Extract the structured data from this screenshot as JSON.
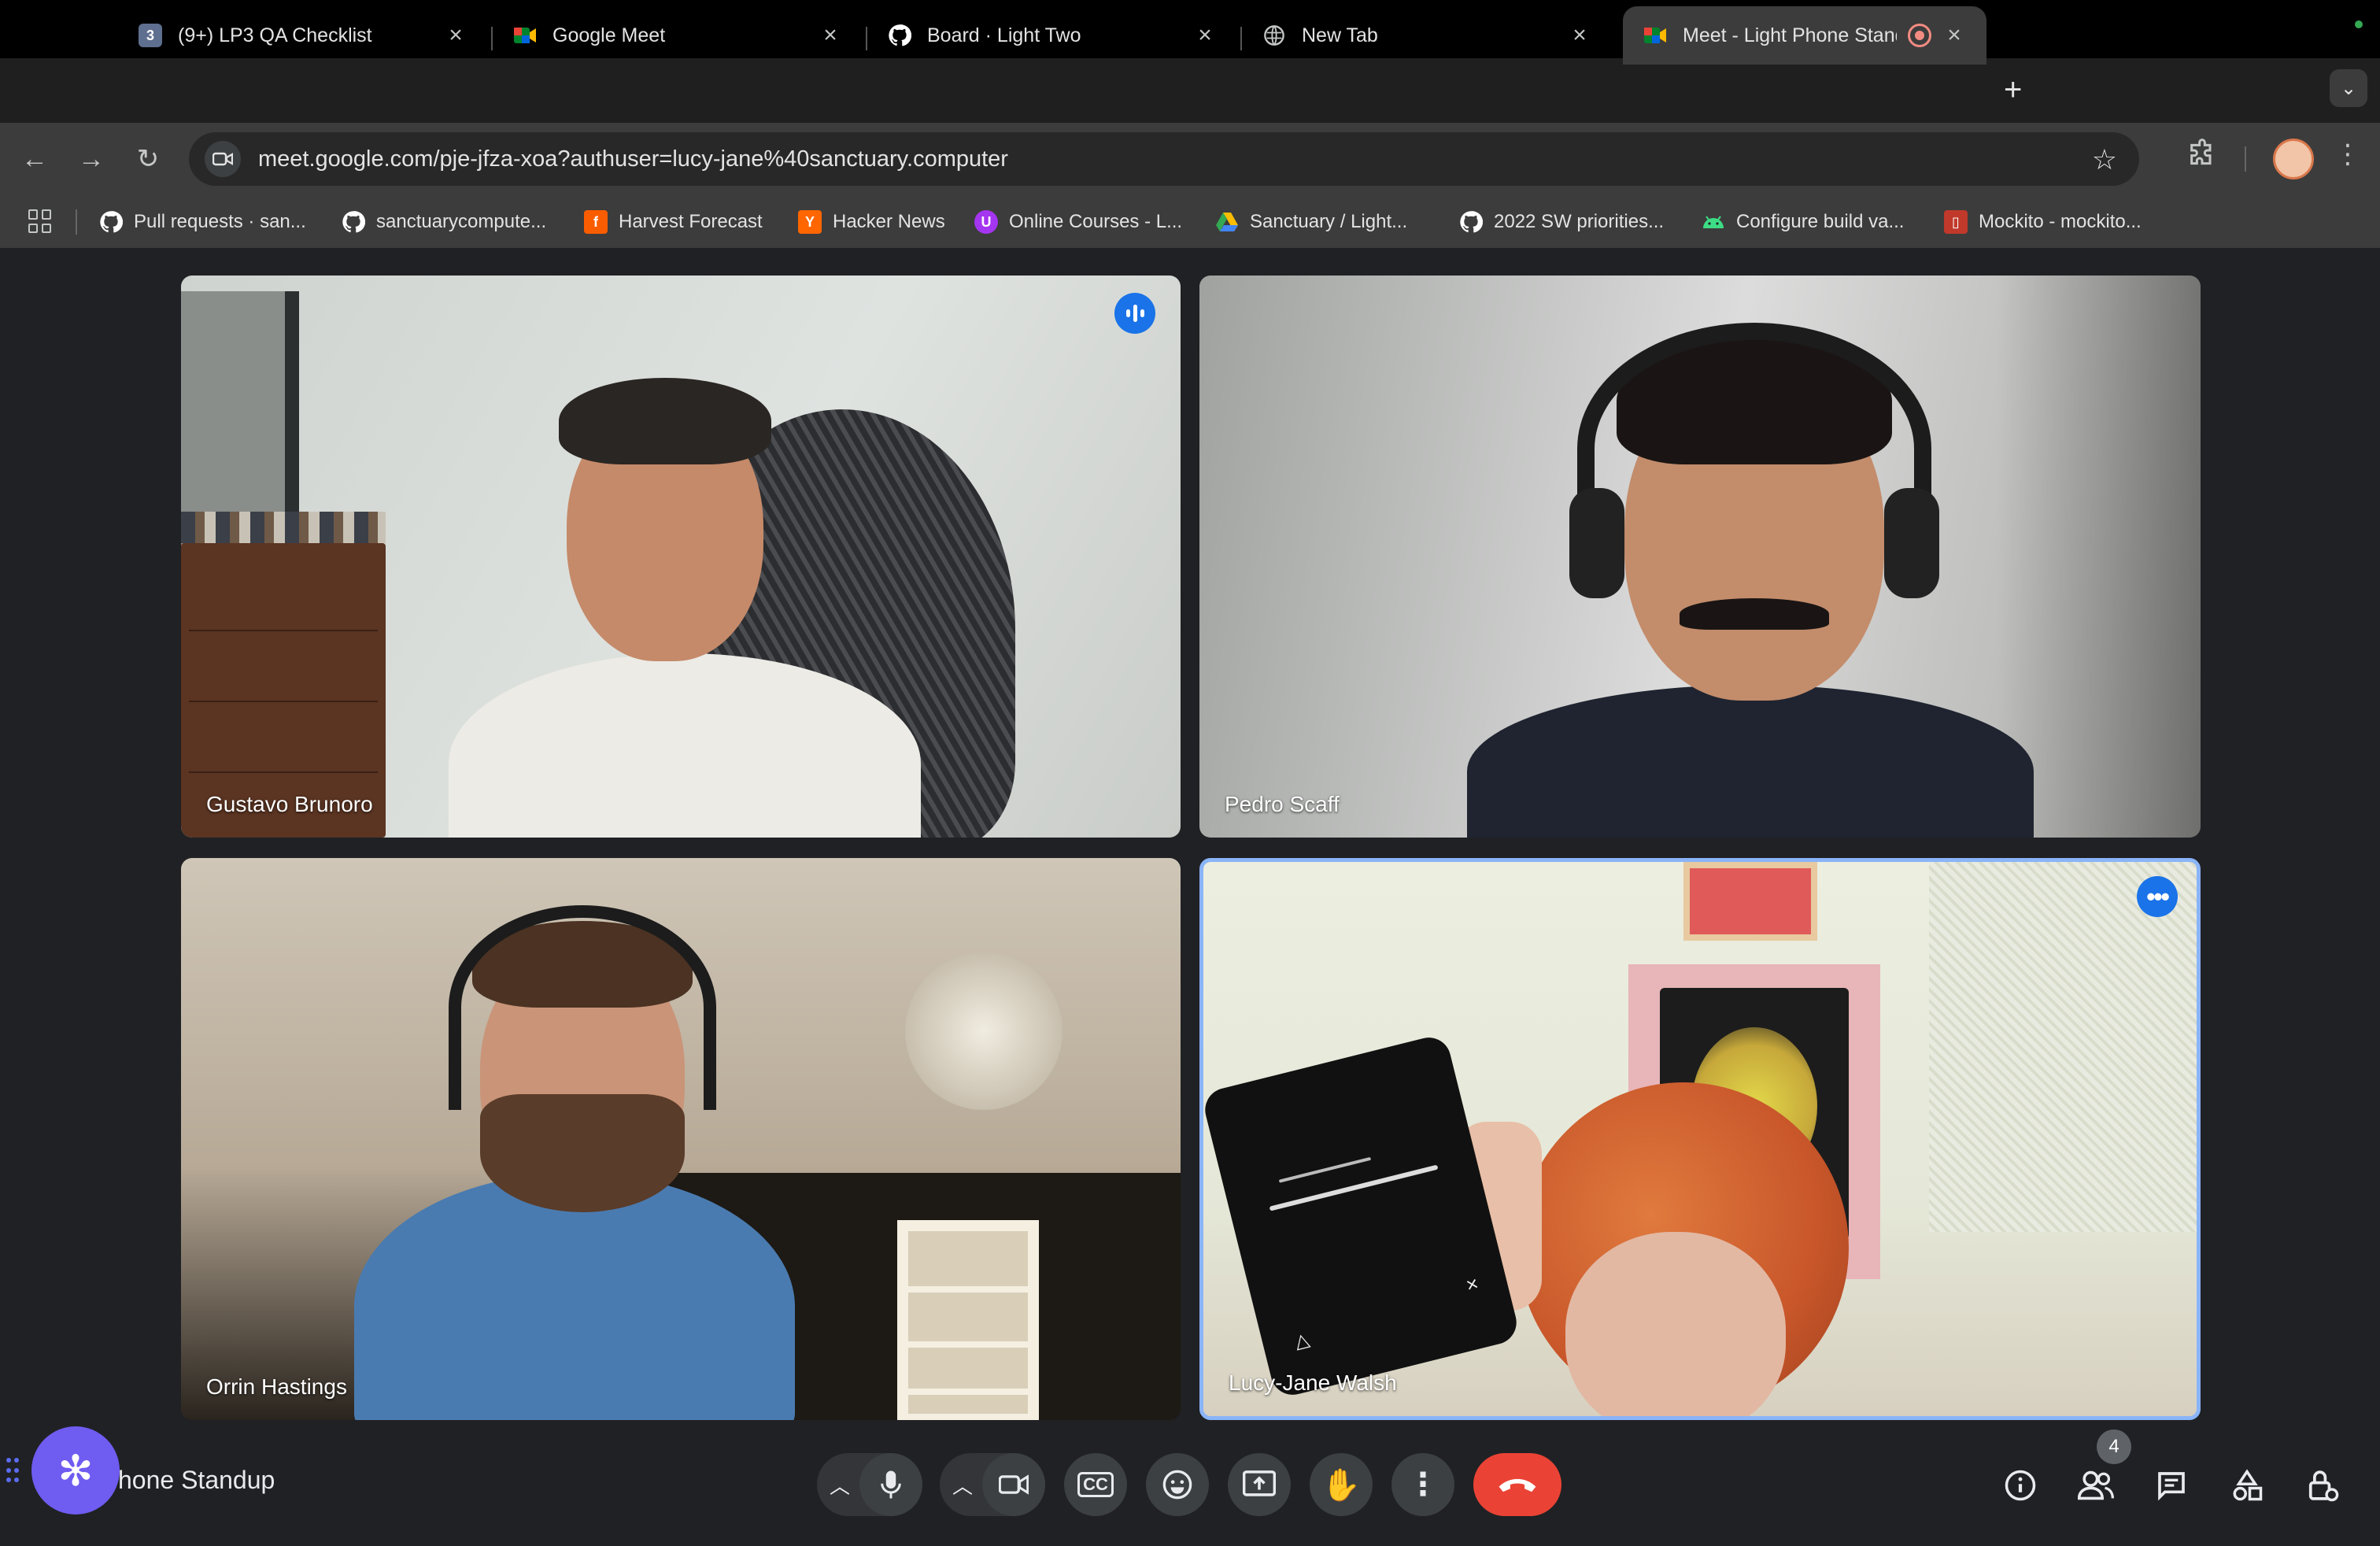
{
  "tabs": [
    {
      "title": "(9+) LP3 QA Checklist",
      "favicon": "3",
      "favicon_color": "#5f6f8f",
      "active": false
    },
    {
      "title": "Google Meet",
      "favicon": "",
      "favicon_color": "#00832d",
      "active": false
    },
    {
      "title": "Board · Light Two",
      "favicon": "",
      "favicon_color": "#ffffff",
      "active": false
    },
    {
      "title": "New Tab",
      "favicon": "",
      "favicon_color": "#c4c7c5",
      "active": false
    },
    {
      "title": "Meet - Light Phone Stand",
      "favicon": "",
      "favicon_color": "#00832d",
      "active": true
    }
  ],
  "address_bar": {
    "url": "meet.google.com/pje-jfza-xoa?authuser=lucy-jane%40sanctuary.computer"
  },
  "bookmarks": [
    {
      "label": "Pull requests · san...",
      "icon": "github-icon",
      "color": "#ffffff"
    },
    {
      "label": "sanctuarycompute...",
      "icon": "github-icon",
      "color": "#ffffff"
    },
    {
      "label": "Harvest Forecast",
      "icon": "harvest-icon",
      "color": "#fa5d00",
      "glyph": "f"
    },
    {
      "label": "Hacker News",
      "icon": "hacker-news-icon",
      "color": "#ff6600",
      "glyph": "Y"
    },
    {
      "label": "Online Courses - L...",
      "icon": "udemy-icon",
      "color": "#a435f0",
      "glyph": "U"
    },
    {
      "label": "Sanctuary / Light...",
      "icon": "drive-icon",
      "color": "#fbbc04"
    },
    {
      "label": "2022 SW priorities...",
      "icon": "github-icon",
      "color": "#ffffff"
    },
    {
      "label": "Configure build va...",
      "icon": "android-icon",
      "color": "#3ddc84"
    },
    {
      "label": "Mockito - mockito...",
      "icon": "mockito-icon",
      "color": "#c0392b"
    }
  ],
  "participants": [
    {
      "name": "Gustavo Brunoro"
    },
    {
      "name": "Pedro Scaff"
    },
    {
      "name": "Orrin Hastings"
    },
    {
      "name": "Lucy-Jane Walsh"
    }
  ],
  "meeting": {
    "title": "hone Standup"
  },
  "people_count": "4",
  "colors": {
    "accent": "#8ab4f8",
    "hangup": "#ea4335",
    "control_bg": "#3c4043",
    "speaking": "#1a73e8"
  }
}
